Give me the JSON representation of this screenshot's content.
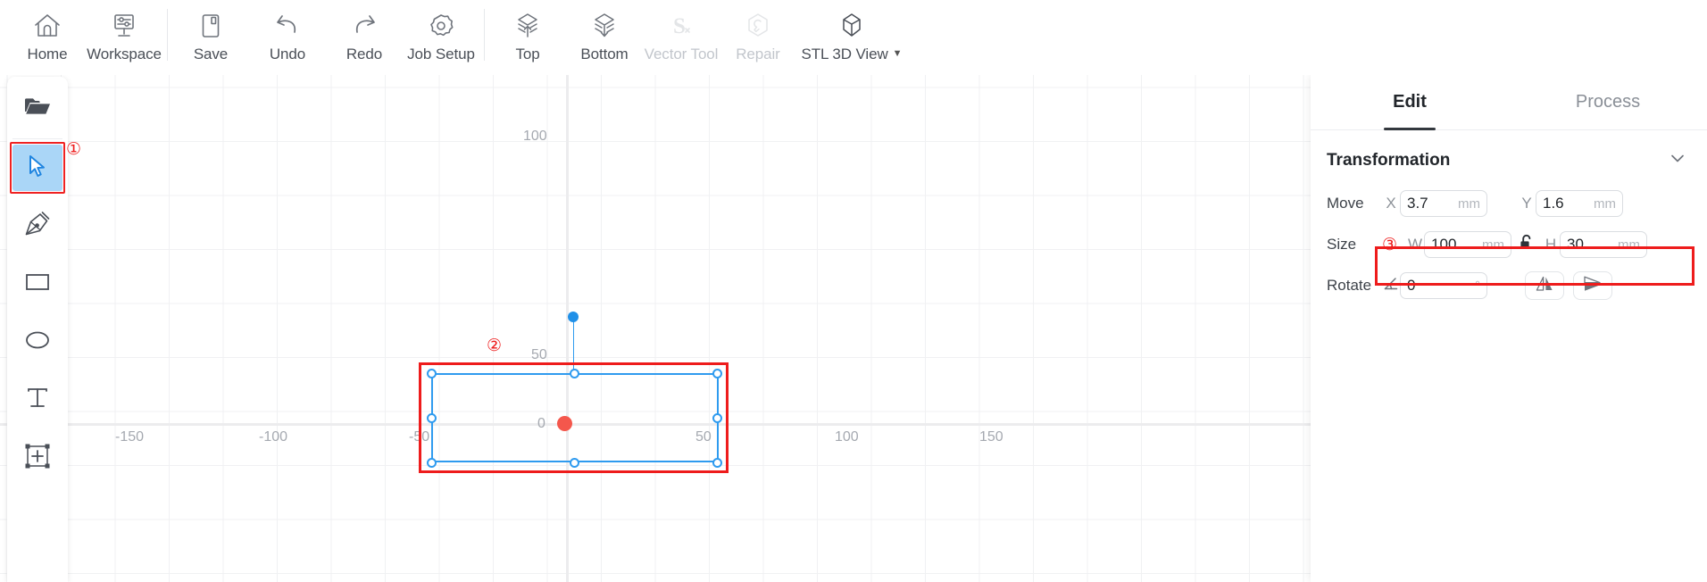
{
  "toolbar": {
    "items": [
      {
        "label": "Home",
        "icon": "home-icon",
        "disabled": false,
        "caret": false
      },
      {
        "label": "Workspace",
        "icon": "workspace-icon",
        "disabled": false,
        "caret": false
      },
      {
        "label": "Save",
        "icon": "save-icon",
        "disabled": false,
        "caret": false
      },
      {
        "label": "Undo",
        "icon": "undo-icon",
        "disabled": false,
        "caret": false
      },
      {
        "label": "Redo",
        "icon": "redo-icon",
        "disabled": false,
        "caret": false
      },
      {
        "label": "Job Setup",
        "icon": "job-setup-icon",
        "disabled": false,
        "caret": false
      },
      {
        "label": "Top",
        "icon": "top-layer-icon",
        "disabled": false,
        "caret": false
      },
      {
        "label": "Bottom",
        "icon": "bottom-layer-icon",
        "disabled": false,
        "caret": false
      },
      {
        "label": "Vector Tool",
        "icon": "vector-tool-icon",
        "disabled": true,
        "caret": false
      },
      {
        "label": "Repair",
        "icon": "repair-icon",
        "disabled": true,
        "caret": false
      },
      {
        "label": "STL 3D View",
        "icon": "stl-3d-view-icon",
        "disabled": false,
        "caret": true
      }
    ]
  },
  "left_rail": {
    "items": [
      {
        "name": "open-file-tool",
        "icon": "folder-open-icon",
        "active": false
      },
      {
        "name": "select-tool",
        "icon": "cursor-arrow-icon",
        "active": true
      },
      {
        "name": "pen-tool",
        "icon": "pen-nib-icon",
        "active": false
      },
      {
        "name": "rectangle-tool",
        "icon": "rectangle-icon",
        "active": false
      },
      {
        "name": "ellipse-tool",
        "icon": "ellipse-icon",
        "active": false
      },
      {
        "name": "text-tool",
        "icon": "text-t-icon",
        "active": false
      },
      {
        "name": "transform-tool",
        "icon": "transform-plus-icon",
        "active": false
      }
    ]
  },
  "canvas": {
    "x_axis_labels": [
      "-150",
      "-100",
      "-50",
      "50",
      "100",
      "150"
    ],
    "y_axis_labels": [
      "100",
      "50"
    ],
    "origin_label": "0",
    "selection": {
      "handles": 8,
      "rotate_handle": true
    }
  },
  "annotations": [
    {
      "marker": "①",
      "target": "select-tool"
    },
    {
      "marker": "②",
      "target": "selected-object"
    },
    {
      "marker": "③",
      "target": "size-fields"
    }
  ],
  "annotation_markers": {
    "one": "①",
    "two": "②",
    "three": "③"
  },
  "right_panel": {
    "tabs": [
      {
        "label": "Edit",
        "active": true
      },
      {
        "label": "Process",
        "active": false
      }
    ],
    "transformation": {
      "title": "Transformation",
      "collapse_icon": "chevron-down-icon",
      "move": {
        "label": "Move",
        "x_label": "X",
        "x_value": "3.7",
        "x_unit": "mm",
        "y_label": "Y",
        "y_value": "1.6",
        "y_unit": "mm"
      },
      "size": {
        "label": "Size",
        "w_label": "W",
        "w_value": "100",
        "w_unit": "mm",
        "h_label": "H",
        "h_value": "30",
        "h_unit": "mm",
        "lock_icon": "unlocked-padlock-icon",
        "highlighted": true
      },
      "rotate": {
        "label": "Rotate",
        "angle_icon": "angle-icon",
        "value": "0",
        "unit": "°",
        "flip_horizontal_icon": "flip-horizontal-icon",
        "flip_vertical_icon": "flip-vertical-icon"
      }
    }
  },
  "colors": {
    "accent_blue": "#2f9bef",
    "annotation_red": "#ee1c1c",
    "origin_red": "#f4574c",
    "active_tool_bg": "#aad6f7",
    "grid": "#f0f1f3",
    "text_dark": "#22262b",
    "text_muted": "#a5a9b0"
  }
}
